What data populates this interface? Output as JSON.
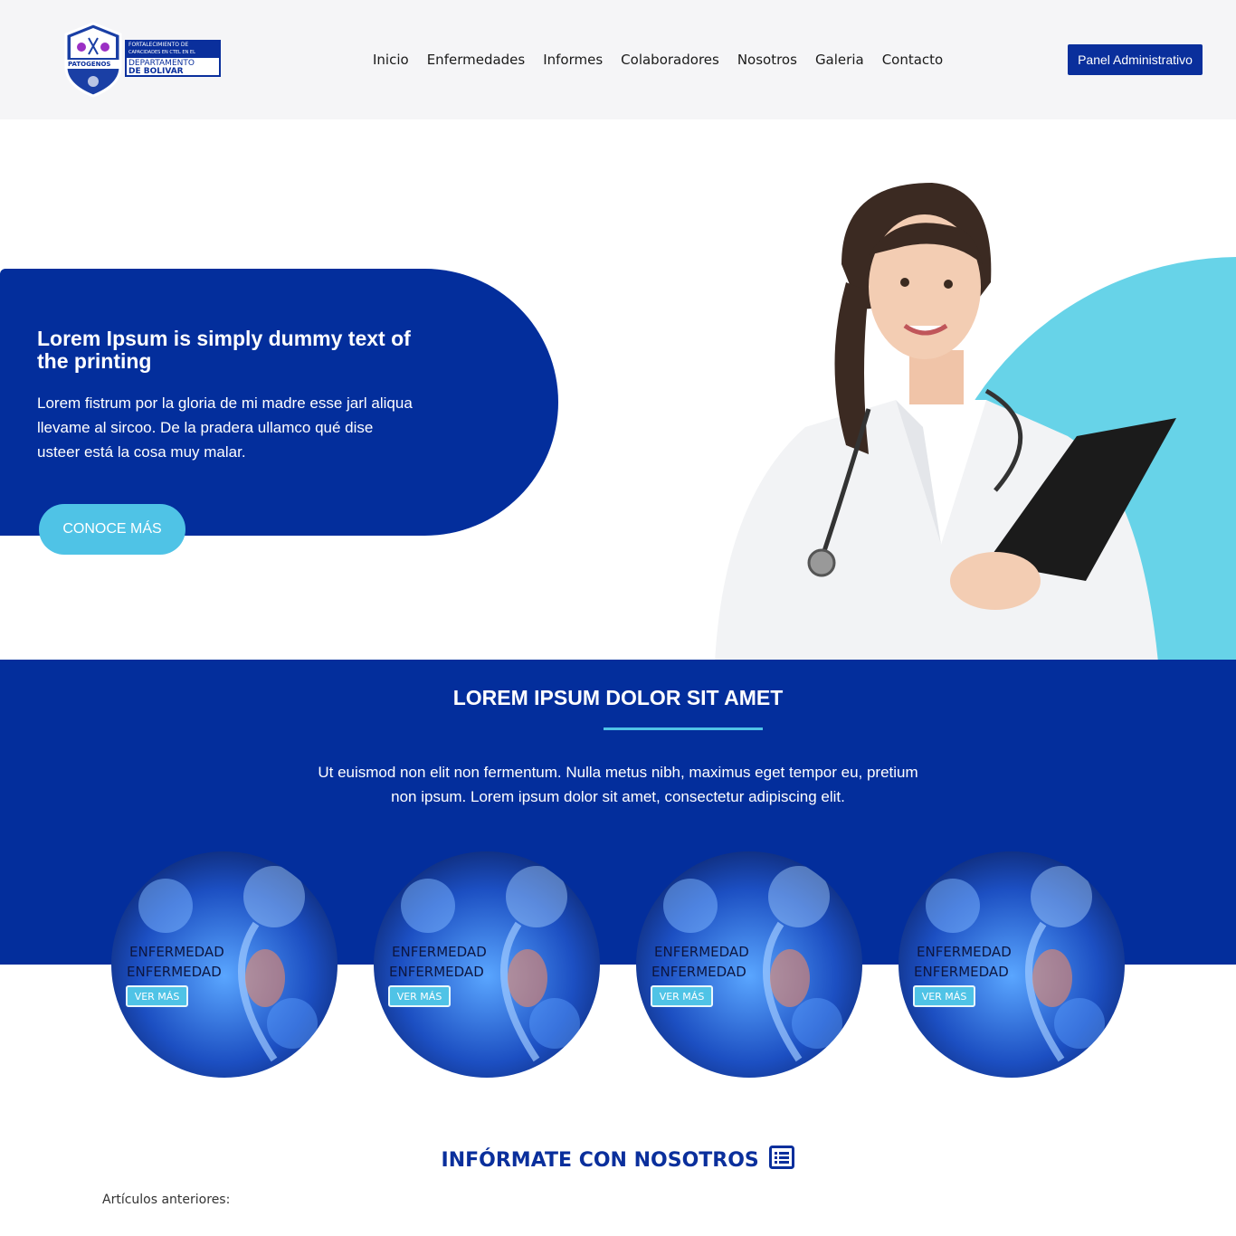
{
  "header": {
    "logo": {
      "brand_text": "PATOGENOS",
      "line1": "FORTALECIMIENTO DE",
      "line2": "CAPACIDADES EN CTEL EN EL",
      "line3": "DEPARTAMENTO",
      "line4": "DE BOLIVAR"
    },
    "nav": [
      "Inicio",
      "Enfermedades",
      "Informes",
      "Colaboradores",
      "Nosotros",
      "Galeria",
      "Contacto"
    ],
    "admin_button": "Panel Administrativo"
  },
  "hero": {
    "title": "Lorem Ipsum is simply dummy text of the printing",
    "text": "Lorem fistrum por la gloria de mi madre esse jarl aliqua llevame al sircoo. De la pradera ullamco qué dise usteer está la cosa muy malar.",
    "button": "CONOCE MÁS",
    "colors": {
      "blob": "#032e9c",
      "accent": "#4fc3e6",
      "circle": "#67d3e8"
    }
  },
  "section": {
    "title": "LOREM IPSUM DOLOR SIT AMET",
    "text": "Ut euismod non elit non fermentum. Nulla metus nibh, maximus eget tempor eu, pretium non ipsum. Lorem ipsum dolor sit amet, consectetur adipiscing elit."
  },
  "cards": [
    {
      "label1": "ENFERMEDAD",
      "label2": "ENFERMEDAD",
      "button": "VER MÁS"
    },
    {
      "label1": "ENFERMEDAD",
      "label2": "ENFERMEDAD",
      "button": "VER MÁS"
    },
    {
      "label1": "ENFERMEDAD",
      "label2": "ENFERMEDAD",
      "button": "VER MÁS"
    },
    {
      "label1": "ENFERMEDAD",
      "label2": "ENFERMEDAD",
      "button": "VER MÁS"
    }
  ],
  "inform": {
    "title": "INFÓRMATE CON NOSOTROS",
    "icon": "list-icon",
    "previous_label": "Artículos anteriores:"
  }
}
